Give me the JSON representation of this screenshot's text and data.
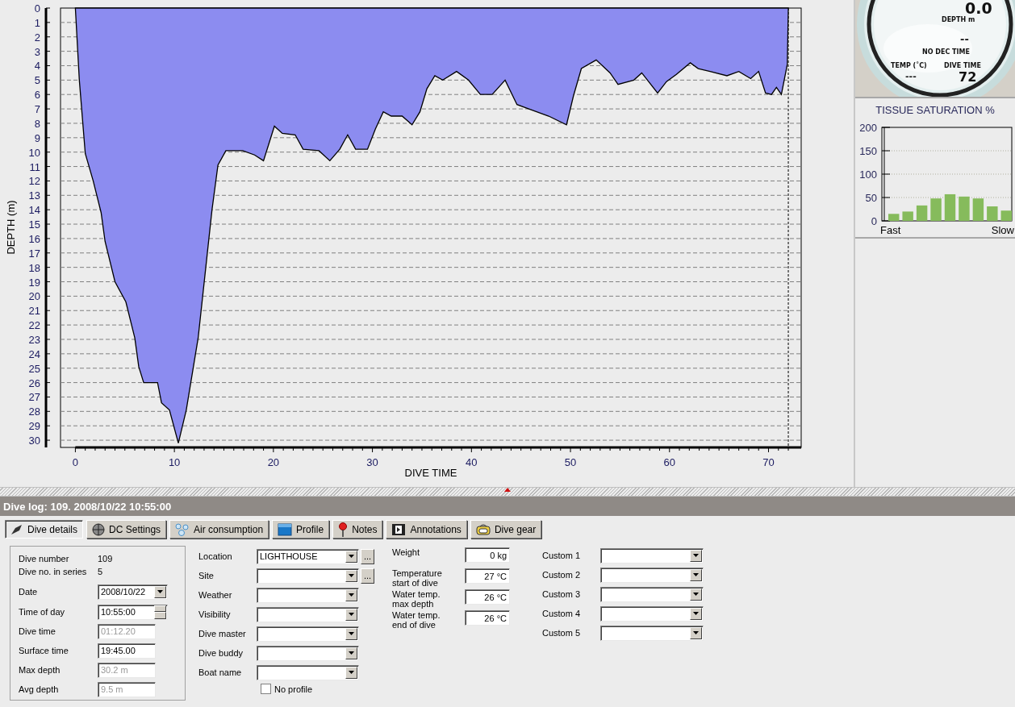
{
  "profile": {
    "chart_data": {
      "type": "area",
      "xlabel": "DIVE TIME",
      "ylabel": "DEPTH (m)",
      "xlim": [
        -1.5,
        73.3
      ],
      "ylim": [
        30.5,
        0
      ],
      "grid": true,
      "ref_lines": [
        {
          "axis": "x",
          "value": 72
        }
      ],
      "xticks": [
        0,
        10,
        20,
        30,
        40,
        50,
        60,
        70
      ],
      "yticks": [
        0,
        1,
        2,
        3,
        4,
        5,
        6,
        7,
        8,
        9,
        10,
        11,
        12,
        13,
        14,
        15,
        16,
        17,
        18,
        19,
        20,
        21,
        22,
        23,
        24,
        25,
        26,
        27,
        28,
        29,
        30
      ],
      "x": [
        0,
        0.4,
        1.0,
        1.8,
        2.6,
        3.0,
        4.0,
        5.1,
        6.0,
        6.4,
        6.9,
        8.3,
        8.7,
        9.5,
        10.4,
        11.2,
        12.4,
        13.8,
        14.4,
        15.2,
        16.9,
        18.1,
        19.0,
        20.1,
        20.9,
        22.2,
        23.0,
        24.6,
        25.7,
        26.7,
        27.5,
        28.3,
        29.5,
        30.3,
        31.1,
        31.9,
        33.0,
        34.0,
        34.8,
        35.5,
        36.3,
        37.1,
        38.5,
        39.7,
        40.9,
        42.1,
        43.4,
        44.6,
        45.8,
        47.8,
        49.6,
        50.3,
        51.1,
        52.6,
        54.0,
        54.8,
        56.4,
        57.2,
        58.8,
        59.7,
        60.7,
        62.1,
        62.9,
        64.1,
        65.8,
        67.0,
        68.2,
        69.0,
        69.7,
        70.3,
        70.8,
        71.3,
        71.9,
        72.0
      ],
      "series": [
        {
          "color": "#8c8cf0",
          "values": [
            0,
            5.0,
            10.1,
            12.0,
            14.2,
            16.2,
            19.0,
            20.4,
            22.9,
            24.9,
            26.0,
            26.0,
            27.4,
            27.9,
            30.2,
            27.9,
            22.9,
            14.0,
            10.9,
            9.9,
            9.9,
            10.2,
            10.6,
            8.2,
            8.7,
            8.8,
            9.8,
            9.9,
            10.6,
            9.8,
            8.8,
            9.8,
            9.8,
            8.4,
            7.2,
            7.5,
            7.5,
            8.1,
            7.2,
            5.6,
            4.7,
            5.0,
            4.4,
            5.0,
            6.0,
            6.0,
            5.0,
            6.7,
            7.0,
            7.5,
            8.1,
            6.1,
            4.2,
            3.6,
            4.5,
            5.3,
            5.0,
            4.5,
            5.9,
            5.1,
            4.6,
            3.8,
            4.2,
            4.4,
            4.7,
            4.4,
            4.9,
            4.4,
            5.9,
            6.0,
            5.5,
            6.0,
            3.9,
            0
          ]
        }
      ]
    }
  },
  "gauge": {
    "depth": "0.0",
    "depth_label": "DEPTH m",
    "deco": "--",
    "deco_label": "NO DEC TIME",
    "temp_label": "TEMP (˚C)",
    "temp": "---",
    "time_label": "DIVE TIME",
    "time": "72"
  },
  "tissue": {
    "title": "TISSUE SATURATION %",
    "chart_data": {
      "type": "bar",
      "ylim": [
        0,
        200
      ],
      "grid": true,
      "yticks": [
        0,
        50,
        100,
        150,
        200
      ],
      "series": [
        {
          "color": "#86bb5c",
          "values": [
            15,
            20,
            33,
            48,
            57,
            52,
            48,
            31,
            22
          ]
        }
      ]
    },
    "end_labels": [
      "Fast",
      "Slow"
    ]
  },
  "dive_log": {
    "title": "Dive log: 109. 2008/10/22 10:55:00"
  },
  "tabs": [
    {
      "label": "Dive details",
      "selected": true
    },
    {
      "label": "DC Settings",
      "selected": false
    },
    {
      "label": "Air consumption",
      "selected": false
    },
    {
      "label": "Profile",
      "selected": false
    },
    {
      "label": "Notes",
      "selected": false
    },
    {
      "label": "Annotations",
      "selected": false
    },
    {
      "label": "Dive gear",
      "selected": false
    }
  ],
  "summary": {
    "fields": [
      {
        "label": "Dive number",
        "value": "109",
        "kind": "plain",
        "disabled": false
      },
      {
        "label": "Dive no. in series",
        "value": "5",
        "kind": "plain",
        "disabled": false
      },
      {
        "label": "Date",
        "value": "2008/10/22",
        "kind": "date",
        "disabled": false
      },
      {
        "label": "Time of day",
        "value": "10:55:00",
        "kind": "spin",
        "disabled": false
      },
      {
        "label": "Dive time",
        "value": "01:12.20",
        "kind": "text",
        "disabled": true
      },
      {
        "label": "Surface time",
        "value": "19:45.00",
        "kind": "text",
        "disabled": false
      },
      {
        "label": "Max depth",
        "value": "30.2 m",
        "kind": "text",
        "disabled": true
      },
      {
        "label": "Avg depth",
        "value": "9.5 m",
        "kind": "text",
        "disabled": true
      }
    ]
  },
  "details": {
    "fields": [
      {
        "label": "Location",
        "value": "LIGHTHOUSE",
        "browse": "..."
      },
      {
        "label": "Site",
        "browse": "..."
      },
      {
        "label": "Weather"
      },
      {
        "label": "Visibility"
      },
      {
        "label": "Dive master"
      },
      {
        "label": "Dive buddy"
      },
      {
        "label": "Boat name"
      }
    ],
    "no_profile": {
      "label": "No profile",
      "checked": false
    }
  },
  "conditions": [
    {
      "label": "Weight",
      "value": "0 kg"
    },
    {
      "label": "Temperature\nstart of dive",
      "value": "27 °C"
    },
    {
      "label": "Water temp.\nmax depth",
      "value": "26 °C"
    },
    {
      "label": "Water temp.\nend of dive",
      "value": "26 °C"
    }
  ],
  "custom": [
    {
      "label": "Custom 1"
    },
    {
      "label": "Custom 2"
    },
    {
      "label": "Custom 3"
    },
    {
      "label": "Custom 4"
    },
    {
      "label": "Custom 5"
    }
  ]
}
